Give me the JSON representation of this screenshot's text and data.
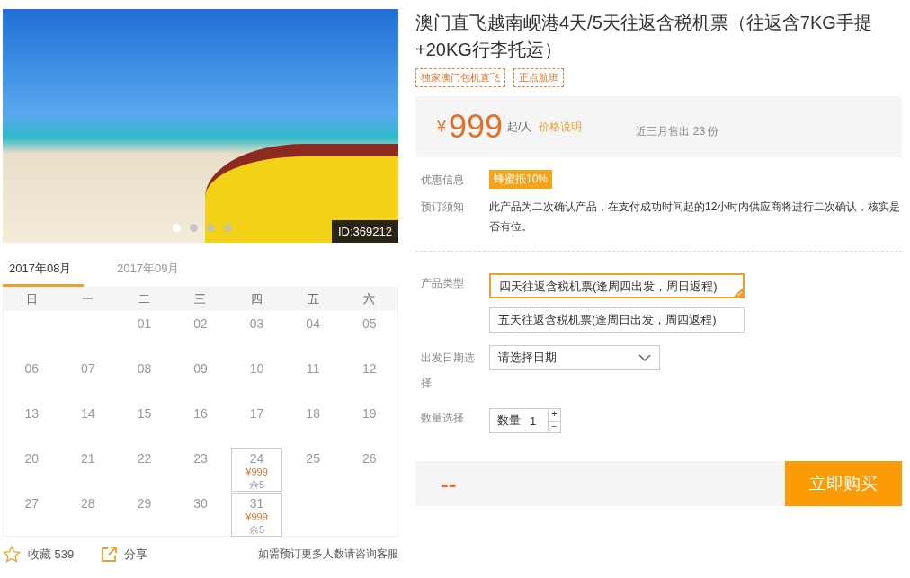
{
  "gallery": {
    "id_badge": "ID:369212",
    "dots": [
      {
        "selected": true
      },
      {
        "selected": false
      },
      {
        "selected": false
      },
      {
        "selected": false
      }
    ]
  },
  "calendar": {
    "tabs": [
      {
        "label": "2017年08月",
        "selected": true
      },
      {
        "label": "2017年09月",
        "selected": false
      }
    ],
    "weekdays": [
      "日",
      "一",
      "二",
      "三",
      "四",
      "五",
      "六"
    ],
    "weeks": [
      [
        {
          "kind": "blank"
        },
        {
          "kind": "blank"
        },
        {
          "kind": "day",
          "day": "01"
        },
        {
          "kind": "day",
          "day": "02"
        },
        {
          "kind": "day",
          "day": "03"
        },
        {
          "kind": "day",
          "day": "04"
        },
        {
          "kind": "day",
          "day": "05"
        }
      ],
      [
        {
          "kind": "day",
          "day": "06"
        },
        {
          "kind": "day",
          "day": "07"
        },
        {
          "kind": "day",
          "day": "08"
        },
        {
          "kind": "day",
          "day": "09"
        },
        {
          "kind": "day",
          "day": "10"
        },
        {
          "kind": "day",
          "day": "11"
        },
        {
          "kind": "day",
          "day": "12"
        }
      ],
      [
        {
          "kind": "day",
          "day": "13"
        },
        {
          "kind": "day",
          "day": "14"
        },
        {
          "kind": "day",
          "day": "15"
        },
        {
          "kind": "day",
          "day": "16"
        },
        {
          "kind": "day",
          "day": "17"
        },
        {
          "kind": "day",
          "day": "18"
        },
        {
          "kind": "day",
          "day": "19"
        }
      ],
      [
        {
          "kind": "day",
          "day": "20"
        },
        {
          "kind": "day",
          "day": "21"
        },
        {
          "kind": "day",
          "day": "22"
        },
        {
          "kind": "day",
          "day": "23"
        },
        {
          "kind": "available",
          "day": "24",
          "price": "¥999",
          "stock": "余5"
        },
        {
          "kind": "day",
          "day": "25"
        },
        {
          "kind": "day",
          "day": "26"
        }
      ],
      [
        {
          "kind": "day",
          "day": "27"
        },
        {
          "kind": "day",
          "day": "28"
        },
        {
          "kind": "day",
          "day": "29"
        },
        {
          "kind": "day",
          "day": "30"
        },
        {
          "kind": "available",
          "day": "31",
          "price": "¥999",
          "stock": "余5"
        },
        {
          "kind": "blank"
        },
        {
          "kind": "blank"
        }
      ]
    ]
  },
  "actions": {
    "favorite": "收藏 539",
    "share": "分享",
    "note": "如需预订更多人数请咨询客服"
  },
  "product": {
    "title": "澳门直飞越南岘港4天/5天往返含税机票（往返含7KG手提+20KG行李托运）",
    "tags": [
      "独家澳门包机直飞",
      "正点航班"
    ],
    "price": {
      "currency": "¥",
      "amount": "999",
      "unit": "起/人",
      "link": "价格说明",
      "sold": "近三月售出 23 份"
    },
    "discount": {
      "label": "优惠信息",
      "badge": "蜂蜜抵10%"
    },
    "notice": {
      "label": "预订须知",
      "text": "此产品为二次确认产品，在支付成功时间起的12小时内供应商将进行二次确认，核实是否有位。"
    },
    "types": {
      "label": "产品类型",
      "options": [
        {
          "label": "四天往返含税机票(逢周四出发，周日返程)",
          "selected": true
        },
        {
          "label": "五天往返含税机票(逢周日出发，周四返程)",
          "selected": false
        }
      ]
    },
    "date": {
      "label": "出发日期选择",
      "placeholder": "请选择日期"
    },
    "quantity": {
      "label": "数量选择",
      "field": "数量",
      "value": "1",
      "plus": "+",
      "minus": "−"
    },
    "total": "--",
    "buy": "立即购买"
  }
}
